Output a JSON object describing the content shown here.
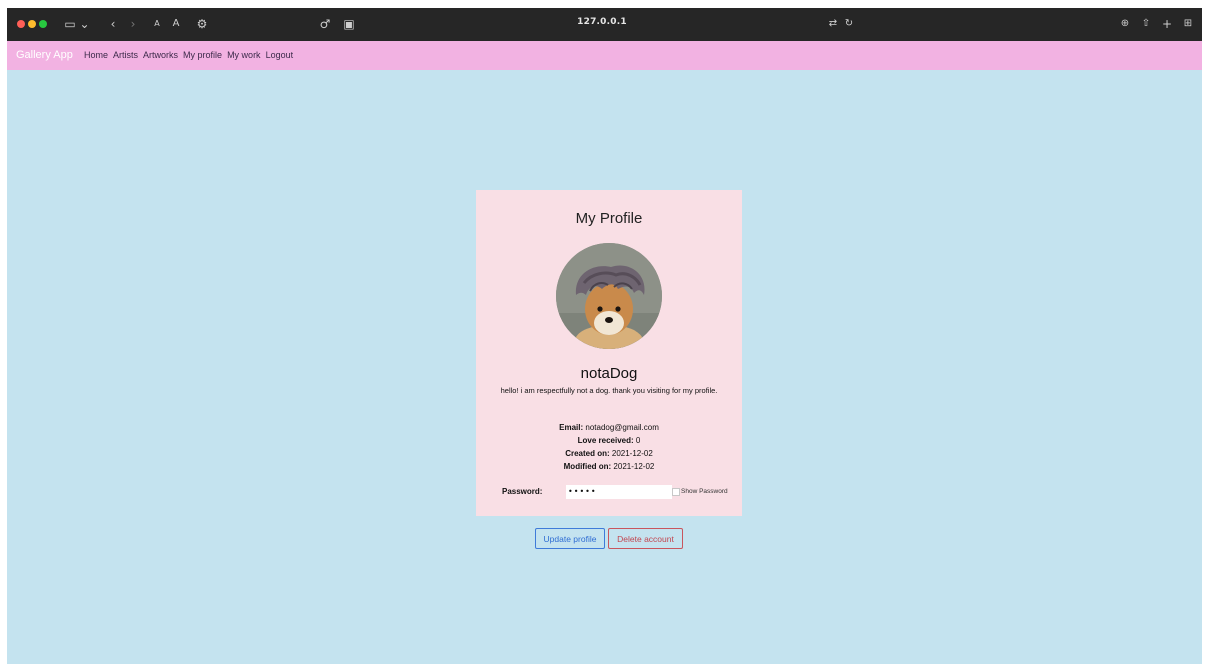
{
  "browser": {
    "url": "127.0.0.1",
    "traffic_lights": [
      "#ff5f57",
      "#febc2e",
      "#28c840"
    ]
  },
  "navbar": {
    "brand": "Gallery App",
    "links": [
      "Home",
      "Artists",
      "Artworks",
      "My profile",
      "My work",
      "Logout"
    ],
    "color": "#f2b2e2"
  },
  "profile": {
    "title": "My Profile",
    "username": "notaDog",
    "bio": "hello! i am respectfully not a dog. thank you visiting for my profile.",
    "email_label": "Email:",
    "email": "notadog@gmail.com",
    "love_label": "Love received:",
    "love": "0",
    "created_label": "Created on:",
    "created": "2021-12-02",
    "modified_label": "Modified on:",
    "modified": "2021-12-02",
    "password_label": "Password:",
    "password_value": "•••••",
    "show_password_label": "Show Password"
  },
  "actions": {
    "update": "Update profile",
    "delete": "Delete account"
  },
  "colors": {
    "page_bg": "#c4e3ef",
    "card_bg": "#f9dfe5",
    "update": "#2f6dd3",
    "delete": "#c24650"
  }
}
